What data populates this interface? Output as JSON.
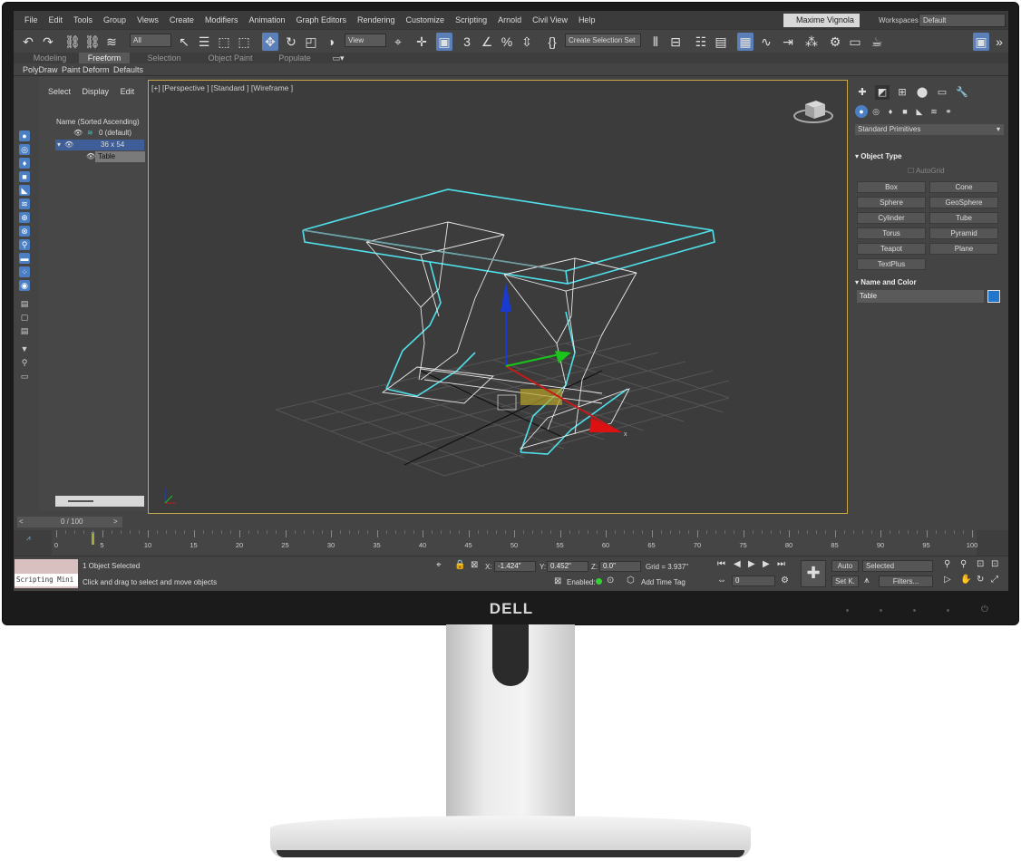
{
  "menu": {
    "items": [
      "File",
      "Edit",
      "Tools",
      "Group",
      "Views",
      "Create",
      "Modifiers",
      "Animation",
      "Graph Editors",
      "Rendering",
      "Customize",
      "Scripting",
      "Arnold",
      "Civil View",
      "Help"
    ],
    "user": "Maxime Vignola ▾",
    "workspaces_label": "Workspaces:",
    "workspace": "Default"
  },
  "toolbar": {
    "filter": "All",
    "coord": "View",
    "selection_set": "Create Selection Set"
  },
  "ribbon": {
    "tabs": [
      "Modeling",
      "Freeform",
      "Selection",
      "Object Paint",
      "Populate"
    ],
    "active_tab": "Freeform",
    "subtabs": [
      "PolyDraw",
      "Paint Deform",
      "Defaults"
    ]
  },
  "explorer": {
    "menu": [
      "Select",
      "Display",
      "Edit"
    ],
    "sort_label": "Name (Sorted Ascending)",
    "layer": "0 (default)",
    "group": "36 x 54",
    "object": "Table"
  },
  "viewport": {
    "label": "[+] [Perspective ] [Standard ] [Wireframe ]"
  },
  "command_panel": {
    "category": "Standard Primitives",
    "object_type_title": "Object Type",
    "autogrid": "AutoGrid",
    "primitives": [
      "Box",
      "Cone",
      "Sphere",
      "GeoSphere",
      "Cylinder",
      "Tube",
      "Torus",
      "Pyramid",
      "Teapot",
      "Plane",
      "TextPlus"
    ],
    "name_color_title": "Name and Color",
    "object_name": "Table",
    "object_color": "#2277cc"
  },
  "timeline": {
    "frame_display": "0 / 100",
    "ticks": [
      0,
      5,
      10,
      15,
      20,
      25,
      30,
      35,
      40,
      45,
      50,
      55,
      60,
      65,
      70,
      75,
      80,
      85,
      90,
      95,
      100
    ]
  },
  "status": {
    "maxscript_label": "Scripting Mini",
    "selected": "1 Object Selected",
    "prompt": "Click and drag to select and move objects",
    "x": "-1.424\"",
    "y": "0.452\"",
    "z": "0.0\"",
    "grid": "Grid = 3.937\"",
    "enabled": "Enabled:",
    "add_time_tag": "Add Time Tag",
    "frame": "0",
    "auto_key": "Auto",
    "set_key": "Set K.",
    "key_filter": "Selected",
    "filters": "Filters..."
  },
  "monitor": {
    "brand": "DELL"
  }
}
